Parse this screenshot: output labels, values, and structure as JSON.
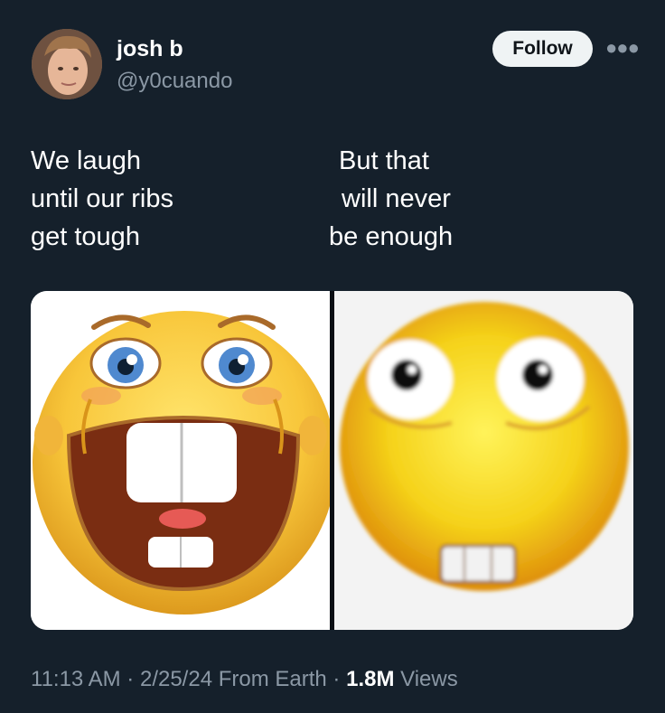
{
  "author": {
    "display_name": "josh b",
    "handle": "@y0cuando",
    "follow_label": "Follow",
    "more_icon": "more-horizontal-icon"
  },
  "tweet": {
    "left_caption": [
      "We laugh",
      "until our ribs",
      "get tough"
    ],
    "right_caption": [
      "But that",
      "will never",
      "be enough"
    ]
  },
  "media": {
    "left_image": "laughing-emoji-with-big-teeth",
    "right_image": "wide-eyed-blurry-emoji"
  },
  "meta": {
    "time": "11:13 AM",
    "date": "2/25/24",
    "source": "From Earth",
    "views_count": "1.8M",
    "views_label": "Views",
    "separator": "·"
  },
  "colors": {
    "background": "#15202b",
    "secondary_text": "#8b98a5",
    "follow_button": "#eff3f4"
  }
}
